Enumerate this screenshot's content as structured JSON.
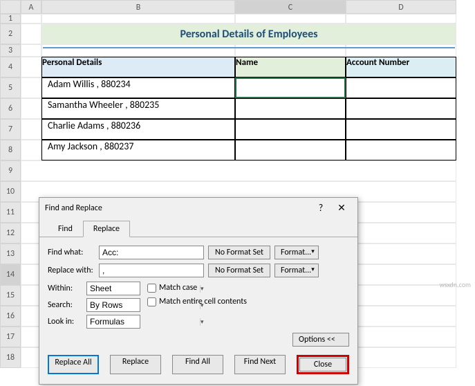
{
  "columns": [
    "",
    "A",
    "B",
    "C",
    "D"
  ],
  "rows": [
    "1",
    "2",
    "3",
    "4",
    "5",
    "6",
    "7",
    "8",
    "9",
    "10",
    "11",
    "12",
    "13",
    "14",
    "15",
    "16",
    "17",
    "18"
  ],
  "title": "Personal Details of Employees",
  "headers": {
    "b": "Personal Details",
    "c": "Name",
    "d": "Account Number"
  },
  "data": [
    "Adam Willis , 880234",
    "Samantha Wheeler , 880235",
    "Charlie Adams , 880236",
    "Amy Jackson , 880237"
  ],
  "dialog": {
    "title": "Find and Replace",
    "help": "?",
    "close_x": "✕",
    "tabs": {
      "find": "Find",
      "replace": "Replace"
    },
    "find_label": "Find what:",
    "find_value": "Acc:",
    "replace_label": "Replace with:",
    "replace_value": ",",
    "no_format": "No Format Set",
    "format_btn": "Format...",
    "within_label": "Within:",
    "within_value": "Sheet",
    "search_label": "Search:",
    "search_value": "By Rows",
    "lookin_label": "Look in:",
    "lookin_value": "Formulas",
    "match_case": "Match case",
    "match_entire": "Match entire cell contents",
    "options_btn": "Options <<",
    "replace_all": "Replace All",
    "replace_btn": "Replace",
    "find_all": "Find All",
    "find_next": "Find Next",
    "close_btn": "Close"
  },
  "watermark": "wsxdn.com"
}
